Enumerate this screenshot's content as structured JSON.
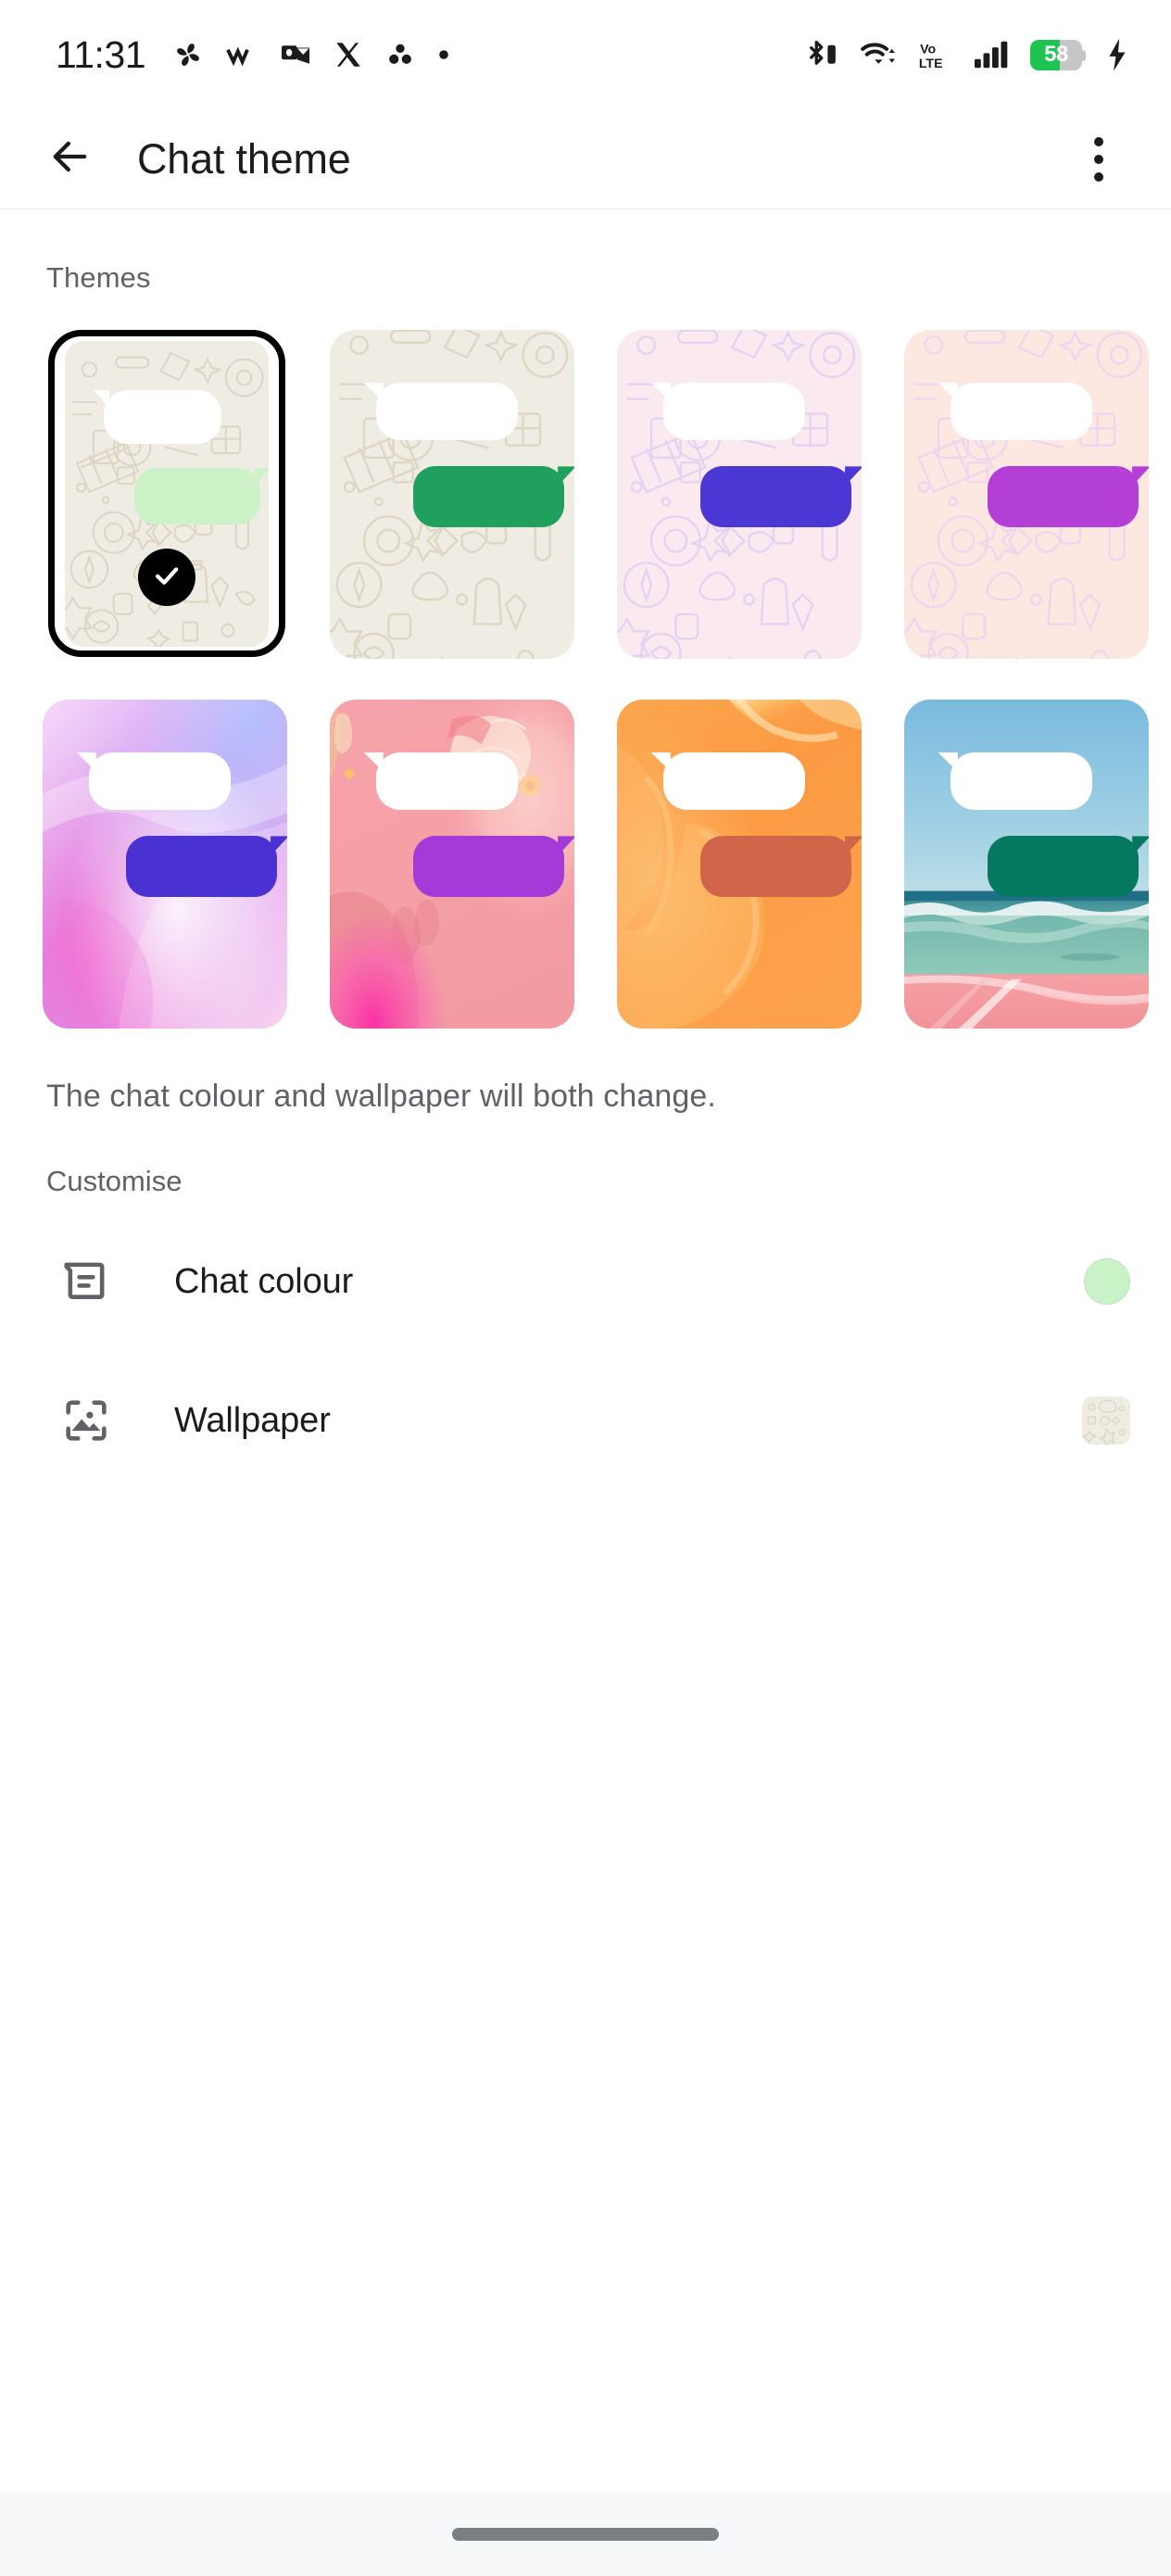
{
  "status_bar": {
    "time": "11:31",
    "left_icons": [
      "pinwheel-icon",
      "medium-m-icon",
      "outlook-icon",
      "x-twitter-icon",
      "asana-icon",
      "dot-icon"
    ],
    "right_icons": [
      "bluetooth-battery-icon",
      "wifi-icon",
      "volte-icon",
      "signal-bars-icon",
      "battery-icon",
      "charging-bolt-icon"
    ],
    "volte_label": "Vo",
    "volte_label2": "LTE",
    "battery_percent": "58",
    "battery_level": 58
  },
  "app_bar": {
    "back_icon": "arrow-back-icon",
    "title": "Chat theme",
    "overflow_icon": "more-vert-icon"
  },
  "themes": {
    "section_label": "Themes",
    "helper_text": "The chat colour and wallpaper will both change.",
    "selected_index": 0,
    "check_icon": "check-icon",
    "items": [
      {
        "name": "default-doodle-light-green",
        "background": "doodle-beige",
        "bg_color": "#efece4",
        "doodle_color": "#e0d9c8",
        "bubble_color": "#cdf2c8",
        "selected": true
      },
      {
        "name": "doodle-green",
        "background": "doodle-beige",
        "bg_color": "#efece4",
        "doodle_color": "#e2dbcb",
        "bubble_color": "#20a05c",
        "selected": false
      },
      {
        "name": "doodle-lavender-indigo",
        "background": "doodle-lavender",
        "bg_color": "#fbe9f0",
        "doodle_color": "#e2d4f0",
        "bubble_color": "#4b37d4",
        "selected": false
      },
      {
        "name": "doodle-blush-purple",
        "background": "doodle-blush",
        "bg_color": "#fce8e0",
        "doodle_color": "#efd6ea",
        "bubble_color": "#b43fd6",
        "selected": false
      },
      {
        "name": "holographic-violet",
        "background": "holographic-pink-purple",
        "bg_color": "#d9a8f0",
        "bubble_color": "#4a32d2",
        "selected": false
      },
      {
        "name": "pink-floral-purple",
        "background": "pink-floral-hand-shadow",
        "bg_color": "#f5a0a8",
        "bubble_color": "#a63ad8",
        "selected": false
      },
      {
        "name": "orange-silk-terracotta",
        "background": "orange-silk",
        "bg_color": "#fba34a",
        "bubble_color": "#d1654a",
        "selected": false
      },
      {
        "name": "beach-ocean-teal",
        "background": "beach-ocean",
        "bg_color": "#7fc0e0",
        "bubble_color": "#05795f",
        "selected": false
      }
    ]
  },
  "customise": {
    "section_label": "Customise",
    "rows": [
      {
        "name": "chat-colour",
        "icon": "chat-bubble-lines-icon",
        "label": "Chat colour",
        "preview_type": "circle",
        "preview_color": "#c9f2c6"
      },
      {
        "name": "wallpaper",
        "icon": "image-frame-icon",
        "label": "Wallpaper",
        "preview_type": "square",
        "preview_color": "#efece4"
      }
    ]
  },
  "nav_bar": {
    "handle": "gesture-home-pill"
  }
}
